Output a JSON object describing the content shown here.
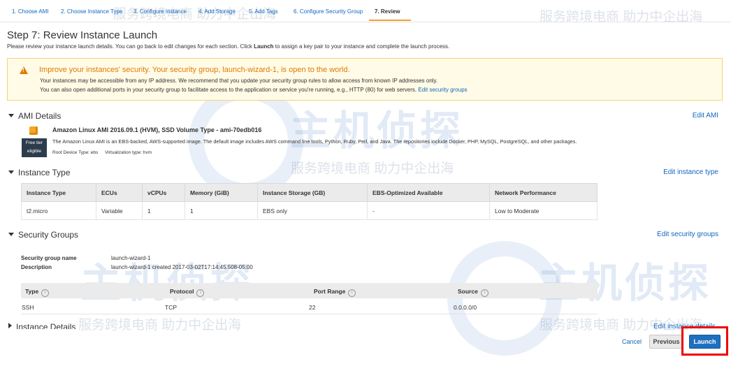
{
  "wizard": {
    "steps": [
      "1. Choose AMI",
      "2. Choose Instance Type",
      "3. Configure Instance",
      "4. Add Storage",
      "5. Add Tags",
      "6. Configure Security Group",
      "7. Review"
    ],
    "active_index": 6
  },
  "page": {
    "title": "Step 7: Review Instance Launch",
    "subtitle_pre": "Please review your instance launch details. You can go back to edit changes for each section. Click ",
    "subtitle_bold": "Launch",
    "subtitle_post": " to assign a key pair to your instance and complete the launch process."
  },
  "warning": {
    "title": "Improve your instances' security. Your security group, launch-wizard-1, is open to the world.",
    "line1": "Your instances may be accessible from any IP address. We recommend that you update your security group rules to allow access from known IP addresses only.",
    "line2": "You can also open additional ports in your security group to facilitate access to the application or service you're running, e.g., HTTP (80) for web servers.",
    "link": "Edit security groups"
  },
  "ami": {
    "heading": "AMI Details",
    "edit": "Edit AMI",
    "name": "Amazon Linux AMI 2016.09.1 (HVM), SSD Volume Type - ami-70edb016",
    "badge_line1": "Free tier",
    "badge_line2": "eligible",
    "description": "The Amazon Linux AMI is an EBS-backed, AWS-supported image. The default image includes AWS command line tools, Python, Ruby, Perl, and Java. The repositories include Docker, PHP, MySQL, PostgreSQL, and other packages.",
    "root_device": "Root Device Type: ebs",
    "virtualization": "Virtualization type: hvm"
  },
  "instance_type": {
    "heading": "Instance Type",
    "edit": "Edit instance type",
    "columns": [
      "Instance Type",
      "ECUs",
      "vCPUs",
      "Memory (GiB)",
      "Instance Storage (GB)",
      "EBS-Optimized Available",
      "Network Performance"
    ],
    "row": [
      "t2.micro",
      "Variable",
      "1",
      "1",
      "EBS only",
      "-",
      "Low to Moderate"
    ]
  },
  "security_groups": {
    "heading": "Security Groups",
    "edit": "Edit security groups",
    "name_label": "Security group name",
    "name_value": "launch-wizard-1",
    "desc_label": "Description",
    "desc_value": "launch-wizard-1 created 2017-03-02T17:14:45.508-05:00",
    "columns": [
      "Type",
      "Protocol",
      "Port Range",
      "Source"
    ],
    "row": [
      "SSH",
      "TCP",
      "22",
      "0.0.0.0/0"
    ]
  },
  "instance_details": {
    "heading": "Instance Details",
    "edit": "Edit instance details"
  },
  "footer": {
    "cancel": "Cancel",
    "previous": "Previous",
    "launch": "Launch"
  },
  "watermarks": {
    "text": "服务跨境电商 助力中企出海",
    "brand": "主机侦探"
  },
  "colors": {
    "link": "#1166bb",
    "warning": "#e07b00",
    "launch_button": "#1f6fbf",
    "highlight": "#e00000"
  }
}
